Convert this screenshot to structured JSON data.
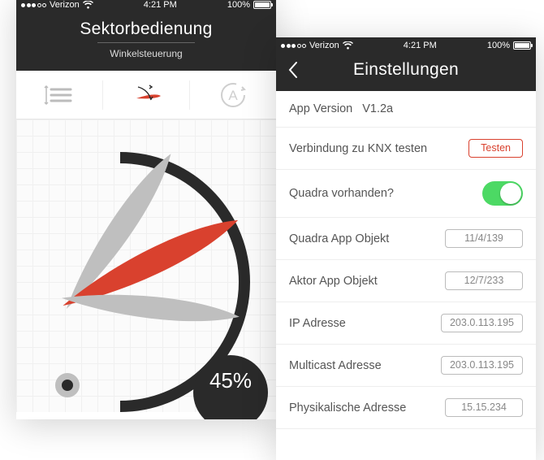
{
  "statusbar": {
    "carrier": "Verizon",
    "time": "4:21 PM",
    "battery": "100%"
  },
  "left": {
    "title": "Sektorbedienung",
    "subtitle": "Winkelsteuerung",
    "percent": "45%"
  },
  "right": {
    "title": "Einstellungen",
    "version_label": "App Version",
    "version_value": "V1.2a",
    "rows": {
      "knx_test_label": "Verbindung zu KNX testen",
      "knx_test_button": "Testen",
      "quadra_label": "Quadra vorhanden?",
      "quadra_app_label": "Quadra App Objekt",
      "quadra_app_value": "11/4/139",
      "aktor_app_label": "Aktor App Objekt",
      "aktor_app_value": "12/7/233",
      "ip_label": "IP Adresse",
      "ip_value": "203.0.113.195",
      "multicast_label": "Multicast Adresse",
      "multicast_value": "203.0.113.195",
      "phys_label": "Physikalische Adresse",
      "phys_value": "15.15.234"
    }
  }
}
